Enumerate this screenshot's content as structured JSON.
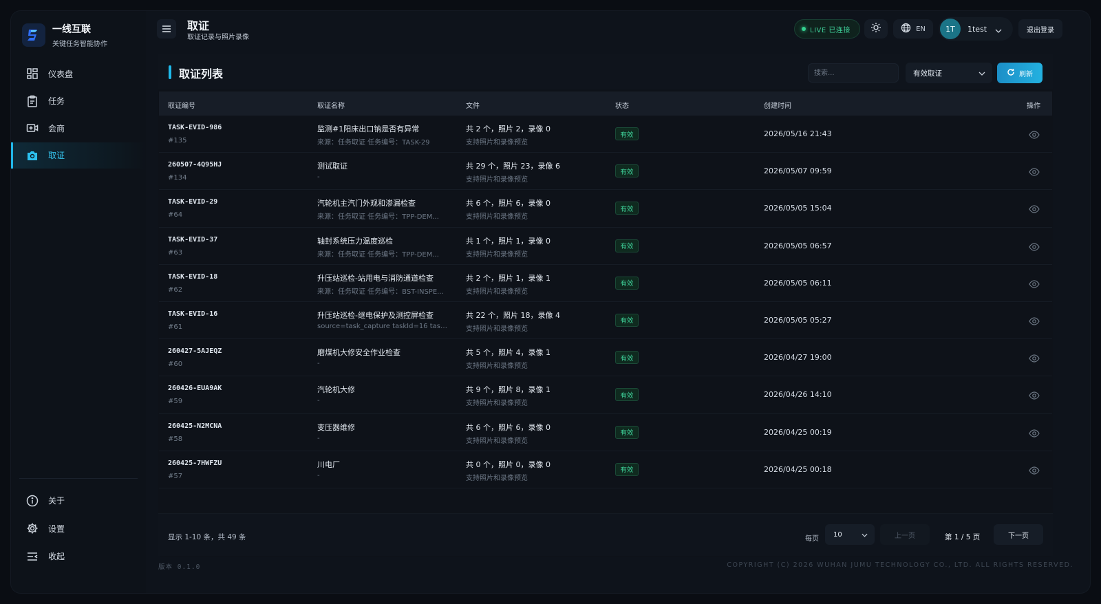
{
  "brand": {
    "name": "一线互联",
    "subtitle": "关键任务智能协作"
  },
  "sidebar": {
    "items": [
      {
        "label": "仪表盘",
        "icon": "dashboard-icon"
      },
      {
        "label": "任务",
        "icon": "clipboard-icon"
      },
      {
        "label": "会商",
        "icon": "video-call-icon"
      },
      {
        "label": "取证",
        "icon": "camera-icon",
        "active": true
      }
    ],
    "bottom_items": [
      {
        "label": "关于",
        "icon": "info-icon"
      },
      {
        "label": "设置",
        "icon": "gear-icon"
      },
      {
        "label": "收起",
        "icon": "collapse-icon"
      }
    ]
  },
  "header": {
    "title": "取证",
    "subtitle": "取证记录与照片录像",
    "live_label": "LIVE 已连接",
    "lang_label": "EN",
    "user_initials": "1T",
    "user_name": "1test",
    "logout_label": "退出登录"
  },
  "card": {
    "title": "取证列表",
    "search_placeholder": "搜索...",
    "filter_value": "有效取证",
    "refresh_label": "刷新"
  },
  "table": {
    "columns": [
      "取证编号",
      "取证名称",
      "文件",
      "状态",
      "创建时间",
      "操作"
    ],
    "rows": [
      {
        "code": "TASK-EVID-986",
        "num": "#135",
        "name": "监测#1阳床出口钠是否有异常",
        "source": "来源：任务取证 任务编号：TASK-29",
        "files": "共 2 个，照片 2，录像 0",
        "files_sub": "支持照片和录像预览",
        "status": "有效",
        "created": "2026/05/16 21:43"
      },
      {
        "code": "260507-4Q95HJ",
        "num": "#134",
        "name": "测试取证",
        "source": "-",
        "files": "共 29 个，照片 23，录像 6",
        "files_sub": "支持照片和录像预览",
        "status": "有效",
        "created": "2026/05/07 09:59"
      },
      {
        "code": "TASK-EVID-29",
        "num": "#64",
        "name": "汽轮机主汽门外观和渗漏检查",
        "source": "来源：任务取证 任务编号：TPP-DEM...",
        "files": "共 6 个，照片 6，录像 0",
        "files_sub": "支持照片和录像预览",
        "status": "有效",
        "created": "2026/05/05 15:04"
      },
      {
        "code": "TASK-EVID-37",
        "num": "#63",
        "name": "轴封系统压力温度巡检",
        "source": "来源：任务取证 任务编号：TPP-DEM...",
        "files": "共 1 个，照片 1，录像 0",
        "files_sub": "支持照片和录像预览",
        "status": "有效",
        "created": "2026/05/05 06:57"
      },
      {
        "code": "TASK-EVID-18",
        "num": "#62",
        "name": "升压站巡检-站用电与消防通道检查",
        "source": "来源：任务取证 任务编号：BST-INSPE...",
        "files": "共 2 个，照片 1，录像 1",
        "files_sub": "支持照片和录像预览",
        "status": "有效",
        "created": "2026/05/05 06:11"
      },
      {
        "code": "TASK-EVID-16",
        "num": "#61",
        "name": "升压站巡检-继电保护及测控屏检查",
        "source": "source=task_capture taskId=16 task...",
        "files": "共 22 个，照片 18，录像 4",
        "files_sub": "支持照片和录像预览",
        "status": "有效",
        "created": "2026/05/05 05:27"
      },
      {
        "code": "260427-5AJEQZ",
        "num": "#60",
        "name": "磨煤机大修安全作业检查",
        "source": "-",
        "files": "共 5 个，照片 4，录像 1",
        "files_sub": "支持照片和录像预览",
        "status": "有效",
        "created": "2026/04/27 19:00"
      },
      {
        "code": "260426-EUA9AK",
        "num": "#59",
        "name": "汽轮机大修",
        "source": "-",
        "files": "共 9 个，照片 8，录像 1",
        "files_sub": "支持照片和录像预览",
        "status": "有效",
        "created": "2026/04/26 14:10"
      },
      {
        "code": "260425-N2MCNA",
        "num": "#58",
        "name": "变压器维修",
        "source": "-",
        "files": "共 6 个，照片 6，录像 0",
        "files_sub": "支持照片和录像预览",
        "status": "有效",
        "created": "2026/04/25 00:19"
      },
      {
        "code": "260425-7HWFZU",
        "num": "#57",
        "name": "川电厂",
        "source": "-",
        "files": "共 0 个，照片 0，录像 0",
        "files_sub": "支持照片和录像预览",
        "status": "有效",
        "created": "2026/04/25 00:18"
      }
    ]
  },
  "pagination": {
    "showing": "显示 1-10 条，共 49 条",
    "per_page_label": "每页",
    "per_page_value": "10",
    "prev_label": "上一页",
    "page_info": "第 1 / 5 页",
    "next_label": "下一页"
  },
  "footer": {
    "version": "版本 0.1.0",
    "copyright": "COPYRIGHT (C) 2026 WUHAN JUMU TECHNOLOGY CO., LTD. ALL RIGHTS RESERVED."
  },
  "colors": {
    "accent": "#21b7e9",
    "success": "#3fd29a",
    "background": "#0e131b"
  }
}
